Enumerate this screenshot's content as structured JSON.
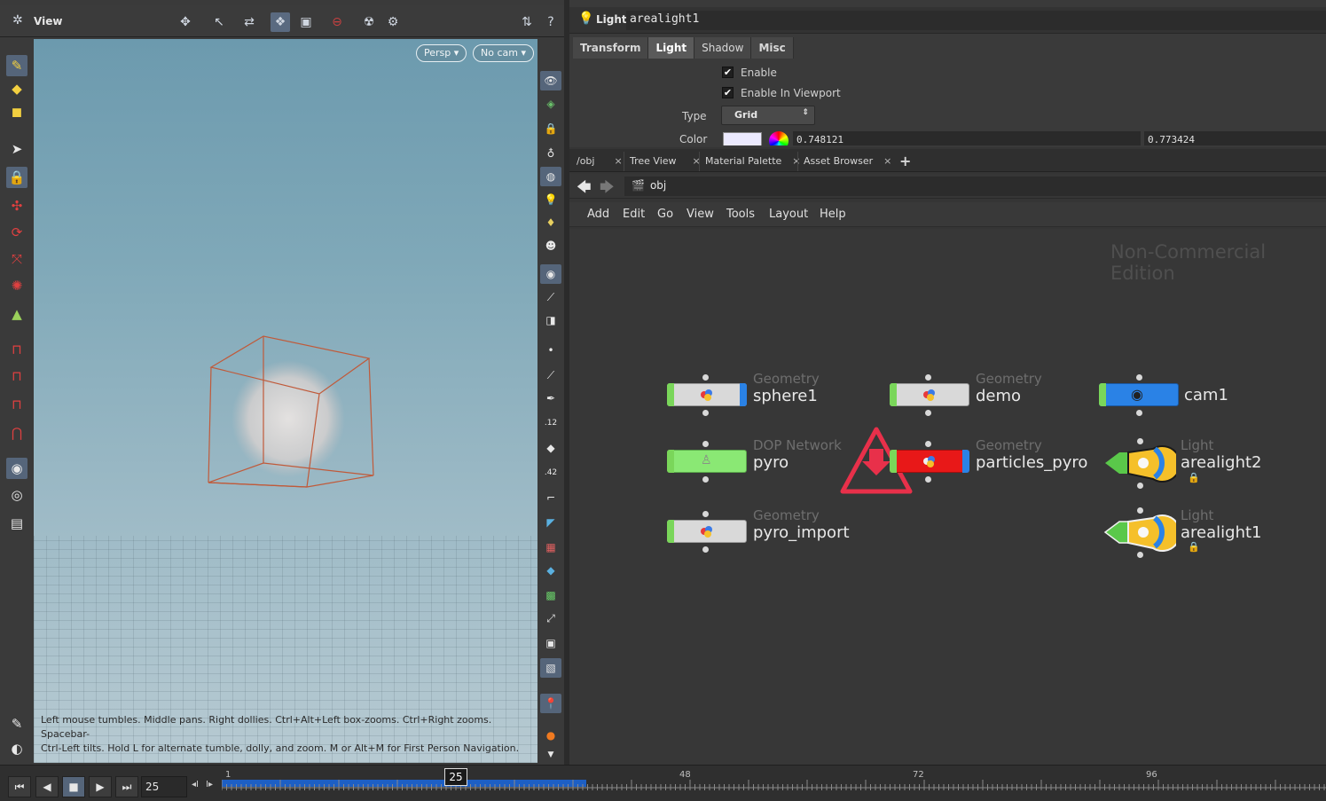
{
  "viewport": {
    "title": "View",
    "persp_label": "Persp",
    "cam_label": "No cam",
    "hint_line1": "Left mouse tumbles. Middle pans. Right dollies. Ctrl+Alt+Left box-zooms. Ctrl+Right zooms. Spacebar-",
    "hint_line2": "Ctrl-Left tilts. Hold L for alternate tumble, dolly, and zoom.     M or Alt+M for First Person Navigation."
  },
  "params": {
    "node_type": "Light",
    "node_name": "arealight1",
    "tabs": [
      "Transform",
      "Light",
      "Shadow",
      "Misc"
    ],
    "active_tab": "Light",
    "enable_label": "Enable",
    "enable_viewport_label": "Enable In Viewport",
    "type_label": "Type",
    "type_value": "Grid",
    "color_label": "Color",
    "color_r": "0.748121",
    "color_g": "0.773424"
  },
  "network": {
    "tabs": [
      "/obj",
      "Tree View",
      "Material Palette",
      "Asset Browser"
    ],
    "path": "obj",
    "menu": [
      "Add",
      "Edit",
      "Go",
      "View",
      "Tools",
      "Layout",
      "Help"
    ],
    "watermark": "Non-Commercial Edition",
    "nodes": [
      {
        "type": "Geometry",
        "name": "sphere1"
      },
      {
        "type": "Geometry",
        "name": "demo"
      },
      {
        "type": "",
        "name": "cam1"
      },
      {
        "type": "DOP Network",
        "name": "pyro"
      },
      {
        "type": "Geometry",
        "name": "particles_pyro"
      },
      {
        "type": "Light",
        "name": "arealight2"
      },
      {
        "type": "Geometry",
        "name": "pyro_import"
      },
      {
        "type": "Light",
        "name": "arealight1"
      }
    ]
  },
  "timeline": {
    "current_frame": "25",
    "ticks": [
      "1",
      "48",
      "72",
      "96"
    ],
    "marker": "25",
    "playback_progress": 0.33
  },
  "colors": {
    "accent_blue": "#2a82e6",
    "warning_red": "#e8304a",
    "light_yellow": "#f5c02a"
  }
}
